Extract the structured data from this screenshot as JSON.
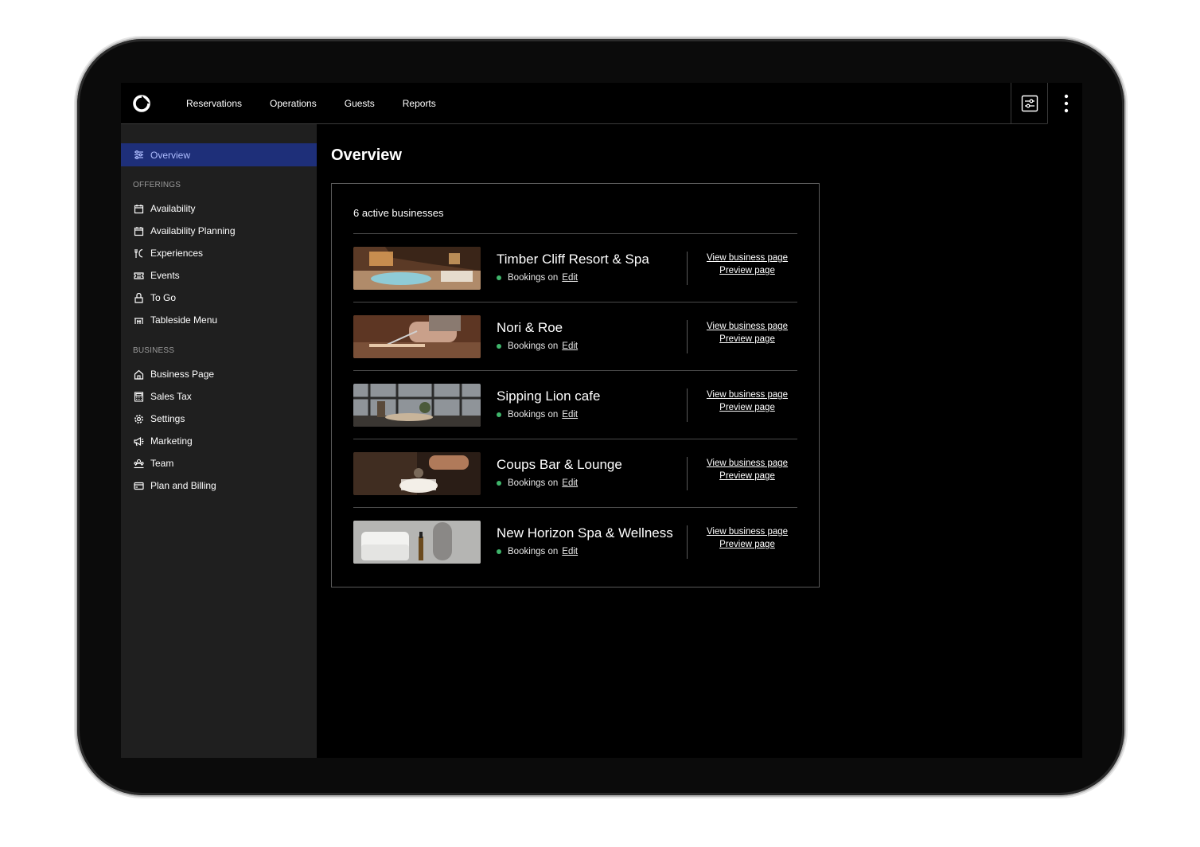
{
  "nav": {
    "items": [
      "Reservations",
      "Operations",
      "Guests",
      "Reports"
    ]
  },
  "sidebar": {
    "active": "Overview",
    "offerings_label": "OFFERINGS",
    "offerings": [
      "Availability",
      "Availability Planning",
      "Experiences",
      "Events",
      "To Go",
      "Tableside Menu"
    ],
    "business_label": "BUSINESS",
    "business": [
      "Business Page",
      "Sales Tax",
      "Settings",
      "Marketing",
      "Team",
      "Plan and Billing"
    ]
  },
  "main": {
    "title": "Overview",
    "card_title": "6 active businesses",
    "businesses": [
      {
        "name": "Timber Cliff Resort & Spa",
        "status": "Bookings on",
        "edit": "Edit",
        "view": "View business page",
        "preview": "Preview page"
      },
      {
        "name": "Nori & Roe",
        "status": "Bookings on",
        "edit": "Edit",
        "view": "View business page",
        "preview": "Preview page"
      },
      {
        "name": "Sipping Lion cafe",
        "status": "Bookings on",
        "edit": "Edit",
        "view": "View business page",
        "preview": "Preview page"
      },
      {
        "name": "Coups Bar & Lounge",
        "status": "Bookings on",
        "edit": "Edit",
        "view": "View business page",
        "preview": "Preview page"
      },
      {
        "name": "New Horizon Spa & Wellness",
        "status": "Bookings on",
        "edit": "Edit",
        "view": "View business page",
        "preview": "Preview page"
      }
    ]
  },
  "colors": {
    "active_bg": "#1e2f79",
    "active_text": "#aebdff",
    "status_green": "#3fb56b",
    "sidebar_bg": "#1f1f1f"
  }
}
